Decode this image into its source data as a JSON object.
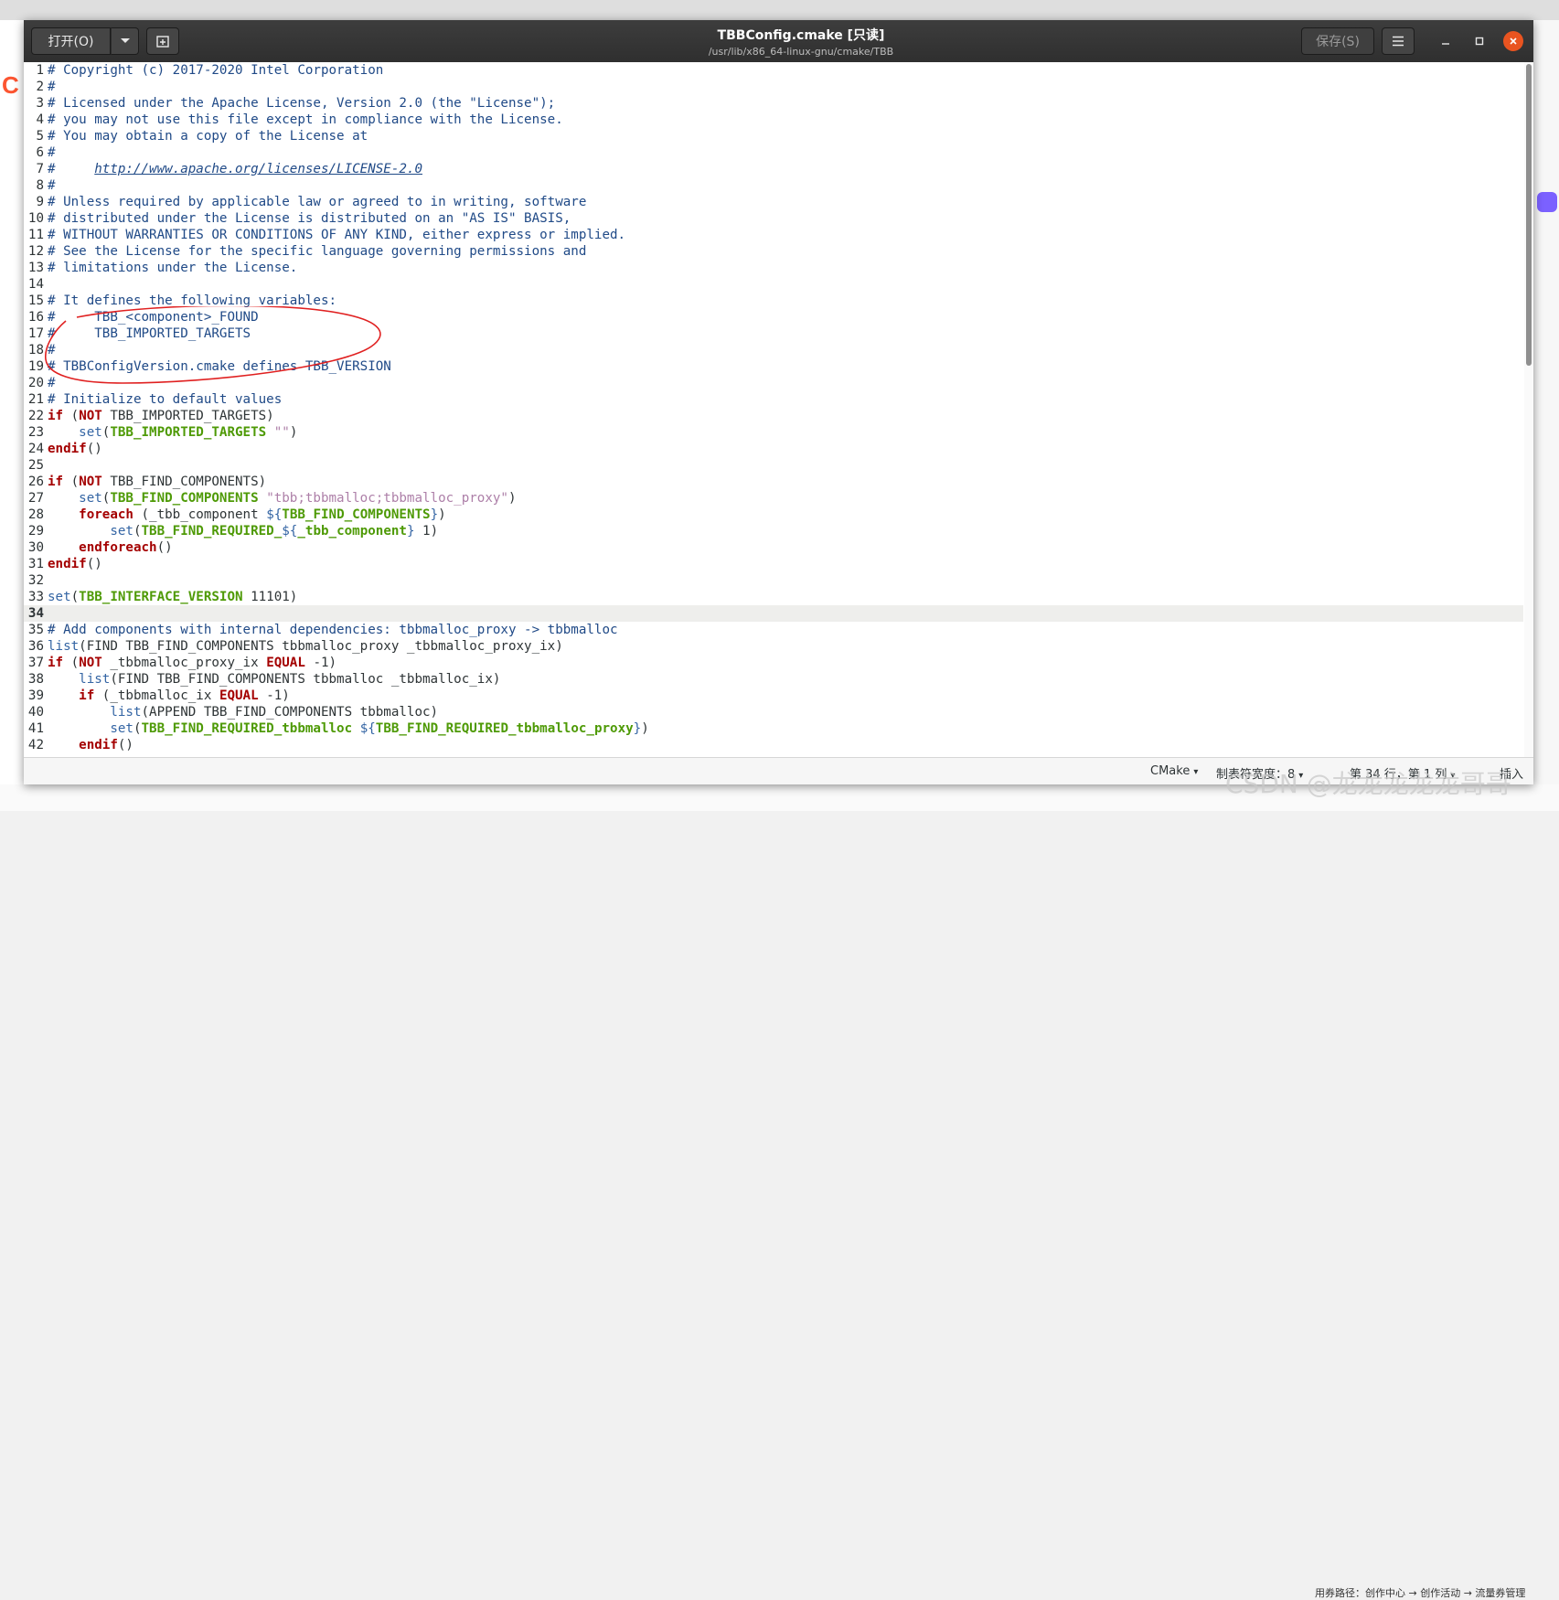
{
  "window": {
    "title": "TBBConfig.cmake [只读]",
    "subtitle": "/usr/lib/x86_64-linux-gnu/cmake/TBB",
    "open_label": "打开(O)",
    "save_label": "保存(S)",
    "menu_icon": "hamburger-icon",
    "pin_icon": "new-tab-icon"
  },
  "background": {
    "logo_text": "C",
    "bottom_text": "用券路径：创作中心 → 创作活动 → 流量券管理",
    "watermark": "CSDN @龙龙龙龙龙哥哥"
  },
  "statusbar": {
    "language": "CMake",
    "tab_width": "制表符宽度：8",
    "position": "第 34 行，第 1 列",
    "mode": "插入"
  },
  "colors": {
    "headerbar": "#2f2f2f",
    "close_button": "#e95420",
    "comment": "#204a87",
    "keyword": "#a40000",
    "variable": "#4e9a06",
    "function": "#3465a4",
    "string": "#ad7fa8",
    "annotation": "#e02020"
  },
  "current_line": 34,
  "lines": [
    {
      "n": "1",
      "t": [
        [
          "c",
          "# Copyright (c) 2017-2020 Intel Corporation"
        ]
      ]
    },
    {
      "n": "2",
      "t": [
        [
          "c",
          "#"
        ]
      ]
    },
    {
      "n": "3",
      "t": [
        [
          "c",
          "# Licensed under the Apache License, Version 2.0 (the \"License\");"
        ]
      ]
    },
    {
      "n": "4",
      "t": [
        [
          "c",
          "# you may not use this file except in compliance with the License."
        ]
      ]
    },
    {
      "n": "5",
      "t": [
        [
          "c",
          "# You may obtain a copy of the License at"
        ]
      ]
    },
    {
      "n": "6",
      "t": [
        [
          "c",
          "#"
        ]
      ]
    },
    {
      "n": "7",
      "t": [
        [
          "c",
          "#     "
        ],
        [
          "l",
          "http://www.apache.org/licenses/LICENSE-2.0"
        ]
      ]
    },
    {
      "n": "8",
      "t": [
        [
          "c",
          "#"
        ]
      ]
    },
    {
      "n": "9",
      "t": [
        [
          "c",
          "# Unless required by applicable law or agreed to in writing, software"
        ]
      ]
    },
    {
      "n": "10",
      "t": [
        [
          "c",
          "# distributed under the License is distributed on an \"AS IS\" BASIS,"
        ]
      ]
    },
    {
      "n": "11",
      "t": [
        [
          "c",
          "# WITHOUT WARRANTIES OR CONDITIONS OF ANY KIND, either express or implied."
        ]
      ]
    },
    {
      "n": "12",
      "t": [
        [
          "c",
          "# See the License for the specific language governing permissions and"
        ]
      ]
    },
    {
      "n": "13",
      "t": [
        [
          "c",
          "# limitations under the License."
        ]
      ]
    },
    {
      "n": "14",
      "t": []
    },
    {
      "n": "15",
      "t": [
        [
          "c",
          "# It defines the following variables:"
        ]
      ]
    },
    {
      "n": "16",
      "t": [
        [
          "c",
          "#     TBB_<component>_FOUND"
        ]
      ]
    },
    {
      "n": "17",
      "t": [
        [
          "c",
          "#     TBB_IMPORTED_TARGETS"
        ]
      ]
    },
    {
      "n": "18",
      "t": [
        [
          "c",
          "#"
        ]
      ]
    },
    {
      "n": "19",
      "t": [
        [
          "c",
          "# TBBConfigVersion.cmake defines TBB_VERSION"
        ]
      ]
    },
    {
      "n": "20",
      "t": [
        [
          "c",
          "#"
        ]
      ]
    },
    {
      "n": "21",
      "t": [
        [
          "c",
          "# Initialize to default values"
        ]
      ]
    },
    {
      "n": "22",
      "t": [
        [
          "k",
          "if"
        ],
        [
          "p",
          " ("
        ],
        [
          "k",
          "NOT"
        ],
        [
          "p",
          " TBB_IMPORTED_TARGETS)"
        ]
      ]
    },
    {
      "n": "23",
      "t": [
        [
          "p",
          "    "
        ],
        [
          "f",
          "set"
        ],
        [
          "p",
          "("
        ],
        [
          "v",
          "TBB_IMPORTED_TARGETS"
        ],
        [
          "p",
          " "
        ],
        [
          "s",
          "\"\""
        ],
        [
          "p",
          ")"
        ]
      ]
    },
    {
      "n": "24",
      "t": [
        [
          "k",
          "endif"
        ],
        [
          "p",
          "()"
        ]
      ]
    },
    {
      "n": "25",
      "t": []
    },
    {
      "n": "26",
      "t": [
        [
          "k",
          "if"
        ],
        [
          "p",
          " ("
        ],
        [
          "k",
          "NOT"
        ],
        [
          "p",
          " TBB_FIND_COMPONENTS)"
        ]
      ]
    },
    {
      "n": "27",
      "t": [
        [
          "p",
          "    "
        ],
        [
          "f",
          "set"
        ],
        [
          "p",
          "("
        ],
        [
          "v",
          "TBB_FIND_COMPONENTS"
        ],
        [
          "p",
          " "
        ],
        [
          "s",
          "\"tbb;tbbmalloc;tbbmalloc_proxy\""
        ],
        [
          "p",
          ")"
        ]
      ]
    },
    {
      "n": "28",
      "t": [
        [
          "p",
          "    "
        ],
        [
          "k",
          "foreach"
        ],
        [
          "p",
          " (_tbb_component "
        ],
        [
          "f",
          "${"
        ],
        [
          "v",
          "TBB_FIND_COMPONENTS"
        ],
        [
          "f",
          "}"
        ],
        [
          "p",
          ")"
        ]
      ]
    },
    {
      "n": "29",
      "t": [
        [
          "p",
          "        "
        ],
        [
          "f",
          "set"
        ],
        [
          "p",
          "("
        ],
        [
          "v",
          "TBB_FIND_REQUIRED_"
        ],
        [
          "f",
          "${"
        ],
        [
          "v",
          "_tbb_component"
        ],
        [
          "f",
          "}"
        ],
        [
          "p",
          " 1)"
        ]
      ]
    },
    {
      "n": "30",
      "t": [
        [
          "p",
          "    "
        ],
        [
          "k",
          "endforeach"
        ],
        [
          "p",
          "()"
        ]
      ]
    },
    {
      "n": "31",
      "t": [
        [
          "k",
          "endif"
        ],
        [
          "p",
          "()"
        ]
      ]
    },
    {
      "n": "32",
      "t": []
    },
    {
      "n": "33",
      "t": [
        [
          "f",
          "set"
        ],
        [
          "p",
          "("
        ],
        [
          "v",
          "TBB_INTERFACE_VERSION"
        ],
        [
          "p",
          " 11101)"
        ]
      ]
    },
    {
      "n": "34",
      "t": []
    },
    {
      "n": "35",
      "t": [
        [
          "c",
          "# Add components with internal dependencies: tbbmalloc_proxy -> tbbmalloc"
        ]
      ]
    },
    {
      "n": "36",
      "t": [
        [
          "f",
          "list"
        ],
        [
          "p",
          "(FIND TBB_FIND_COMPONENTS tbbmalloc_proxy _tbbmalloc_proxy_ix)"
        ]
      ]
    },
    {
      "n": "37",
      "t": [
        [
          "k",
          "if"
        ],
        [
          "p",
          " ("
        ],
        [
          "k",
          "NOT"
        ],
        [
          "p",
          " _tbbmalloc_proxy_ix "
        ],
        [
          "k",
          "EQUAL"
        ],
        [
          "p",
          " -1)"
        ]
      ]
    },
    {
      "n": "38",
      "t": [
        [
          "p",
          "    "
        ],
        [
          "f",
          "list"
        ],
        [
          "p",
          "(FIND TBB_FIND_COMPONENTS tbbmalloc _tbbmalloc_ix)"
        ]
      ]
    },
    {
      "n": "39",
      "t": [
        [
          "p",
          "    "
        ],
        [
          "k",
          "if"
        ],
        [
          "p",
          " (_tbbmalloc_ix "
        ],
        [
          "k",
          "EQUAL"
        ],
        [
          "p",
          " -1)"
        ]
      ]
    },
    {
      "n": "40",
      "t": [
        [
          "p",
          "        "
        ],
        [
          "f",
          "list"
        ],
        [
          "p",
          "(APPEND TBB_FIND_COMPONENTS tbbmalloc)"
        ]
      ]
    },
    {
      "n": "41",
      "t": [
        [
          "p",
          "        "
        ],
        [
          "f",
          "set"
        ],
        [
          "p",
          "("
        ],
        [
          "v",
          "TBB_FIND_REQUIRED_tbbmalloc"
        ],
        [
          "p",
          " "
        ],
        [
          "f",
          "${"
        ],
        [
          "v",
          "TBB_FIND_REQUIRED_tbbmalloc_proxy"
        ],
        [
          "f",
          "}"
        ],
        [
          "p",
          ")"
        ]
      ]
    },
    {
      "n": "42",
      "t": [
        [
          "p",
          "    "
        ],
        [
          "k",
          "endif"
        ],
        [
          "p",
          "()"
        ]
      ]
    }
  ]
}
